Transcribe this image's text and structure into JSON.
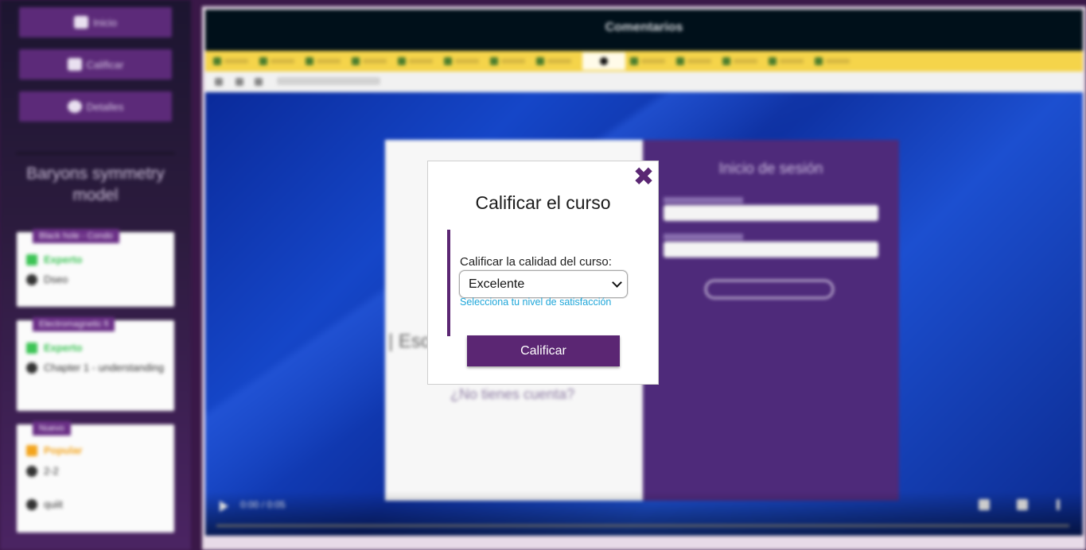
{
  "sidebar": {
    "buttons": [
      {
        "label": "Inicio",
        "icon": "home-icon"
      },
      {
        "label": "Calificar",
        "icon": "thumbs-up-icon"
      },
      {
        "label": "Detalles",
        "icon": "info-icon"
      }
    ],
    "course_title": "Baryons symmetry model",
    "cards": [
      {
        "tag": "Black hole - Condo",
        "level": "Experto",
        "level_color": "#3cc455",
        "items": [
          "Dseo"
        ]
      },
      {
        "tag": "Electromagnetic fi",
        "level": "Experto",
        "level_color": "#3cc455",
        "items": [
          "Chapter 1 - understanding"
        ]
      },
      {
        "tag": "Nuevo",
        "level": "Popular",
        "level_color": "#f3a41c",
        "items": [
          "2-2",
          "quiit"
        ]
      }
    ]
  },
  "video": {
    "title": "Comentarios",
    "time": "0:00 / 0:05",
    "login_header": "Inicio de sesión",
    "login_question": "¿No tienes cuenta?",
    "login_big": "| Eso"
  },
  "modal": {
    "title": "Calificar el curso",
    "label": "Calificar la calidad del curso:",
    "selected": "Excelente",
    "hint": "Selecciona tu nivel de satisfacción",
    "submit": "Calificar",
    "close_glyph": "✖",
    "accent_color": "#5b2673",
    "hint_color": "#1ea6d9"
  }
}
